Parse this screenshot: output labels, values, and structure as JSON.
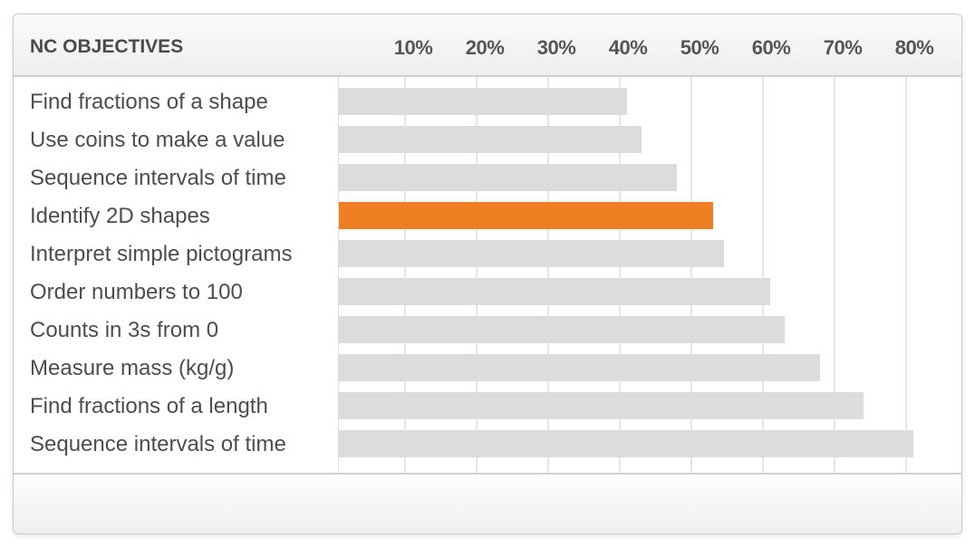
{
  "chart_data": {
    "type": "bar",
    "orientation": "horizontal",
    "title": "NC OBJECTIVES",
    "xlabel": "",
    "ylabel": "",
    "xlim": [
      0,
      80
    ],
    "x_ticks": [
      "10%",
      "20%",
      "30%",
      "40%",
      "50%",
      "60%",
      "70%",
      "80%"
    ],
    "x_tick_values": [
      10,
      20,
      30,
      40,
      50,
      60,
      70,
      80
    ],
    "grid": true,
    "categories": [
      "Find fractions of a shape",
      "Use coins to make a value",
      "Sequence intervals of time",
      "Identify 2D shapes",
      "Interpret simple pictograms",
      "Order numbers to 100",
      "Counts in 3s from 0",
      "Measure mass (kg/g)",
      "Find fractions of a length",
      "Sequence intervals of time"
    ],
    "values": [
      41,
      43,
      48,
      53,
      54.5,
      61,
      63,
      68,
      74,
      81
    ],
    "highlighted_index": 3,
    "colors": {
      "default_bar": "#dcdcdc",
      "highlight_bar": "#f07f23",
      "gridline": "#e6e6e6",
      "text": "#4d4d4d"
    }
  }
}
